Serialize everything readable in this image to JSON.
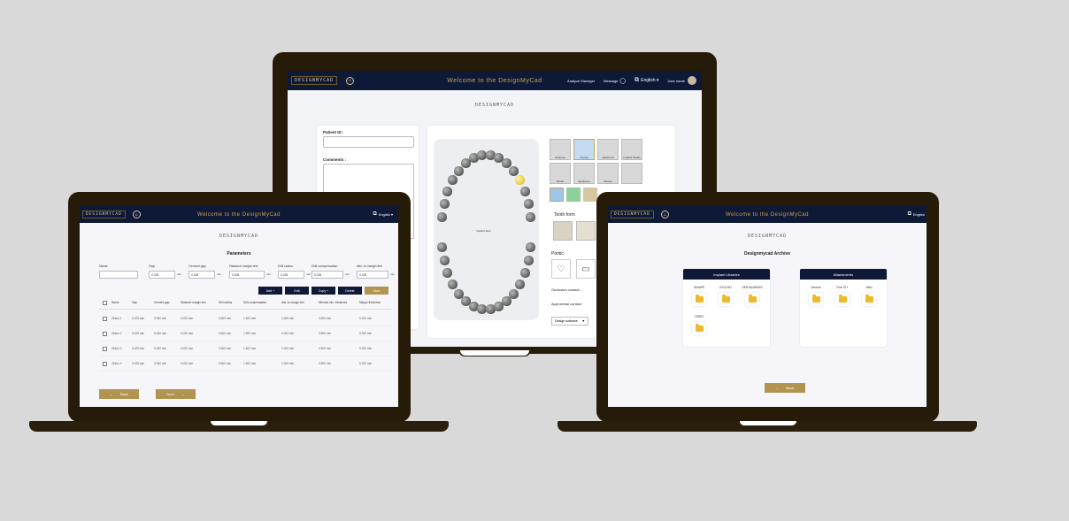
{
  "colors": {
    "background": "#d9d9d9",
    "navbar": "#0e1937",
    "gold": "#b1944f",
    "title_gold": "#c9a44e",
    "folder": "#f0b92a"
  },
  "center": {
    "logo": "DESIGNMYCAD",
    "title": "Welcome to the DesignMyCad",
    "nav": {
      "analysis": "Analyze Manager",
      "message": "Message",
      "language": "English ▾",
      "user": "User name"
    },
    "page_logo": "DESIGNMYCAD",
    "patient_id_label": "Patient ID :",
    "comments_label": "Comments :",
    "restorations": [
      "Anatomy",
      "Coping",
      "Abutment",
      "Implant Studio",
      "Model",
      "Appliance",
      "Waxup",
      ""
    ],
    "tooth_tag": "Implant abut",
    "tooth_form_label": "Tooth form",
    "pontic_label": "Pontic",
    "occlusion_label": "Occlusion contact :",
    "approximal_label": "Approximal contact",
    "design_software": "Design software",
    "design_software_arrow": "▼"
  },
  "left": {
    "logo": "DESIGNMYCAD",
    "title": "Welcome to the DesignMyCad",
    "language": "English ▾",
    "page_logo": "DESIGNMYCAD",
    "heading": "Parameters",
    "fields": [
      {
        "label": "Name",
        "value": ""
      },
      {
        "label": "Gap",
        "value": "0.025",
        "unit": "mm"
      },
      {
        "label": "Cement gap",
        "value": "0.025",
        "unit": "mm"
      },
      {
        "label": "Distance margin line",
        "value": "0.025",
        "unit": "mm"
      },
      {
        "label": "Drill radius",
        "value": "0.025",
        "unit": "mm"
      },
      {
        "label": "Drill compensation",
        "value": "0.025",
        "unit": "mm"
      },
      {
        "label": "dist. to margin line",
        "value": "0.025",
        "unit": "mm"
      }
    ],
    "buttons": {
      "add": "Add +",
      "edit": "Edit",
      "copy": "Copy +",
      "delete": "Delete",
      "save": "Save"
    },
    "columns": [
      "Name",
      "Gap",
      "Cement gap",
      "Distance margin line",
      "Drill radius",
      "Drill compensation",
      "dist. to margin line",
      "Minimal min. thickness",
      "Margin thickness"
    ],
    "rows": [
      [
        "Zirkon 1",
        "0.025 mm",
        "0.050 mm",
        "0.020 mm",
        "0.600 mm",
        "1.500 mm",
        "1.000 mm",
        "0.500 mm",
        "0.200 mm"
      ],
      [
        "Zirkon 2",
        "0.025 mm",
        "0.050 mm",
        "0.020 mm",
        "0.600 mm",
        "1.500 mm",
        "1.000 mm",
        "0.500 mm",
        "0.200 mm"
      ],
      [
        "Zirkon 3",
        "0.025 mm",
        "0.050 mm",
        "0.020 mm",
        "0.600 mm",
        "1.500 mm",
        "1.000 mm",
        "0.500 mm",
        "0.200 mm"
      ],
      [
        "Zirkon 4",
        "0.025 mm",
        "0.050 mm",
        "0.020 mm",
        "0.600 mm",
        "1.500 mm",
        "1.000 mm",
        "0.500 mm",
        "0.200 mm"
      ]
    ],
    "back_label": "Back",
    "next_label": "Next"
  },
  "right": {
    "logo": "DESIGNMYCAD",
    "title": "Welcome to the DesignMyCad",
    "language": "English",
    "page_logo": "DESIGNMYCAD",
    "heading": "Designmycad Archive",
    "implant_title": "Implant Libraries",
    "implant_folders": [
      "3SHAPE",
      "EXOCAD",
      "DENTALWINGS",
      "CEREC"
    ],
    "attachments_title": "Attachments",
    "attachment_folders": [
      "Denture",
      "Free STL",
      "Hello"
    ],
    "back_label": "Back"
  }
}
